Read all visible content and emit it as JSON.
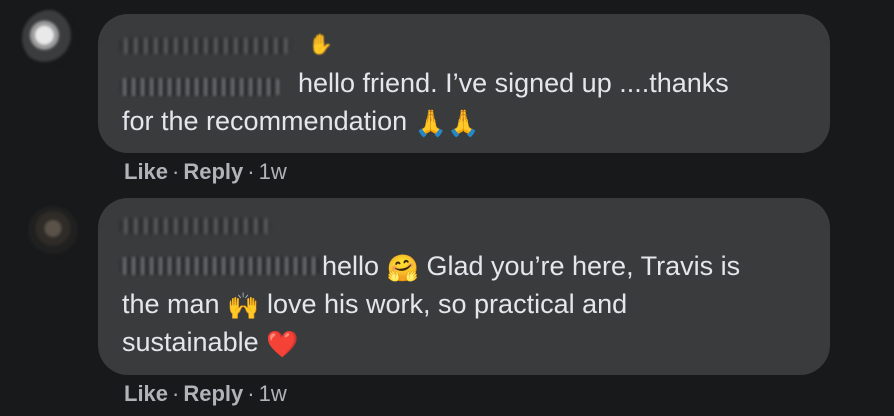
{
  "comments": [
    {
      "text_line1": "hello friend. I’ve signed up ....thanks",
      "text_line2": "for the recommendation",
      "emoji_after": "🙏🙏",
      "actions": {
        "like": "Like",
        "reply": "Reply",
        "time": "1w"
      }
    },
    {
      "text_line1_start": "hello",
      "text_line1_emoji": "🤗",
      "text_line1_end": "Glad you’re here, Travis is",
      "text_line2_start": "the man",
      "text_line2_emoji": "🙌",
      "text_line2_end": "love his work, so practical and",
      "text_line3": "sustainable",
      "text_line3_emoji": "❤️",
      "actions": {
        "like": "Like",
        "reply": "Reply",
        "time": "1w"
      }
    }
  ],
  "icons": {
    "wave": "waving-hand-icon",
    "pray": "folded-hands-icon",
    "hug": "hugging-face-icon",
    "raised_hands": "raising-hands-icon",
    "heart": "red-heart-icon"
  },
  "colors": {
    "background": "#18191a",
    "bubble": "#3a3b3c",
    "text": "#e4e6eb",
    "secondary_text": "#b0b3b8",
    "heart": "#f33e58"
  }
}
